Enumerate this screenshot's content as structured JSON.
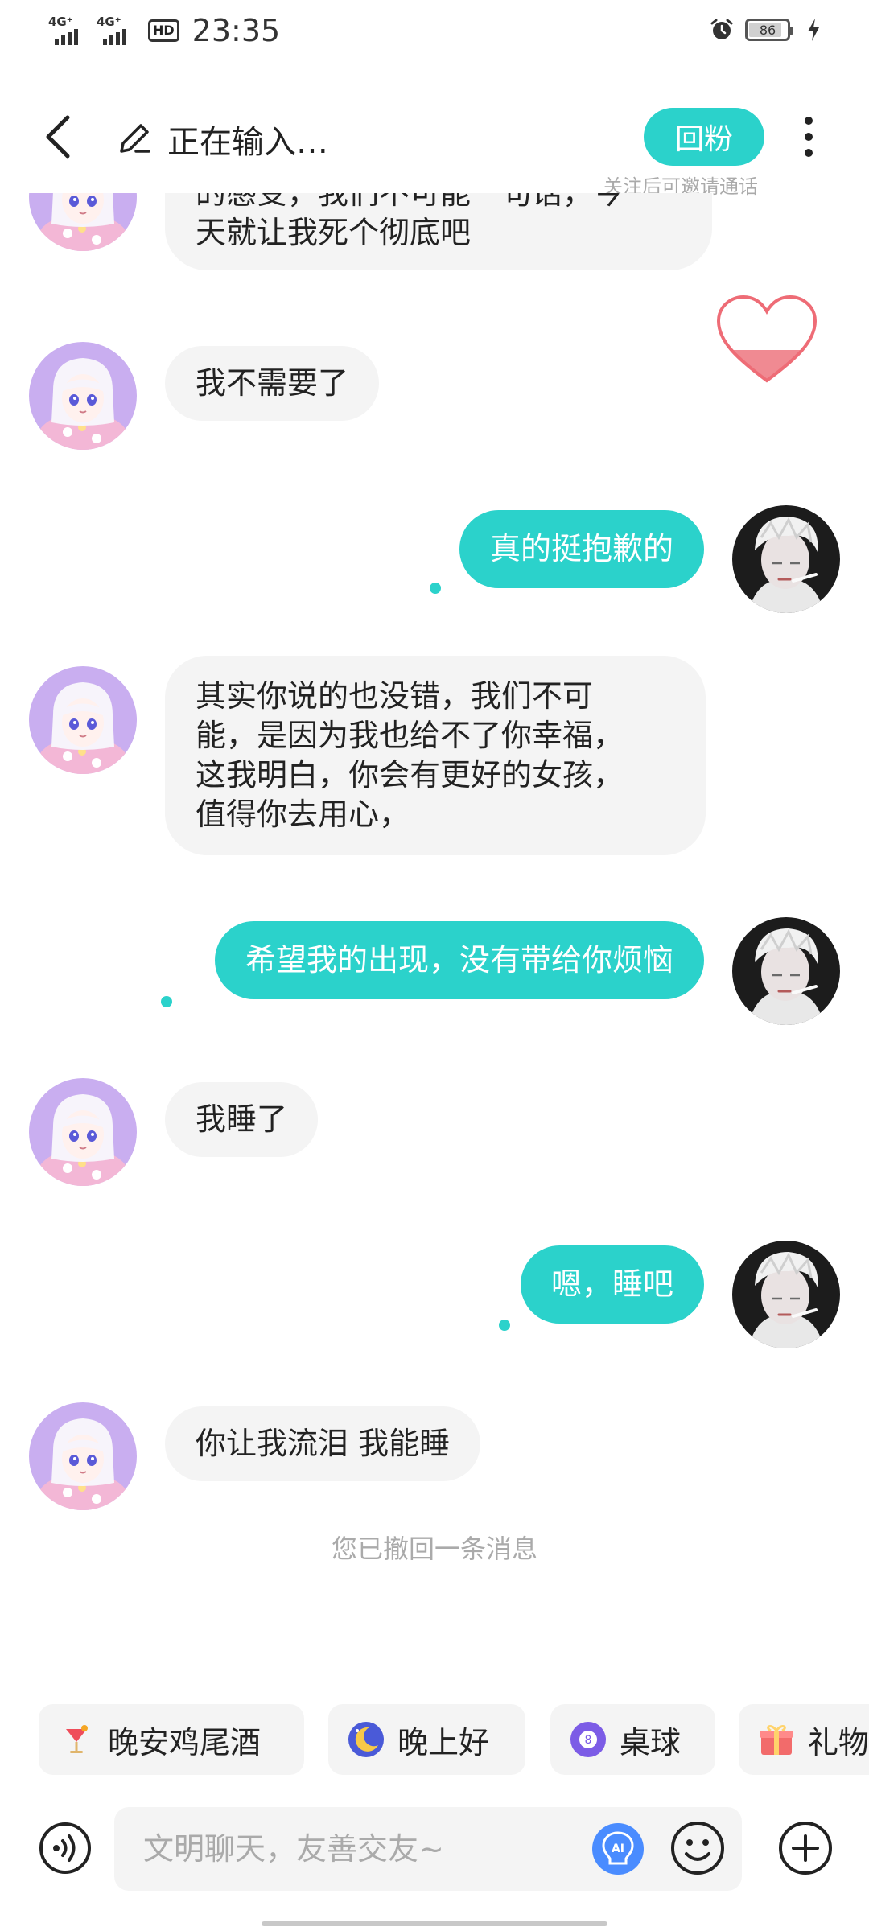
{
  "status_bar": {
    "sim1": "4G⁺",
    "sim2": "4G⁺",
    "hd": "HD",
    "time": "23:35",
    "battery_level": "86"
  },
  "header": {
    "title": "正在输入…",
    "follow_back": "回粉",
    "follow_hint": "关注后可邀请通话"
  },
  "messages": [
    {
      "side": "left",
      "text_lines": [
        "的感受，我们不可能一句话，今",
        "天就让我死个彻底吧"
      ]
    },
    {
      "side": "left",
      "text": "我不需要了"
    },
    {
      "side": "right",
      "text": "真的挺抱歉的"
    },
    {
      "side": "left",
      "text_lines": [
        "其实你说的也没错，我们不可",
        "能，是因为我也给不了你幸福，",
        "这我明白，你会有更好的女孩，",
        "值得你去用心，"
      ]
    },
    {
      "side": "right",
      "text": "希望我的出现，没有带给你烦恼"
    },
    {
      "side": "left",
      "text": "我睡了"
    },
    {
      "side": "right",
      "text": "嗯，睡吧"
    },
    {
      "side": "left",
      "text": "你让我流泪 我能睡"
    }
  ],
  "recall_notice": "您已撤回一条消息",
  "quick_replies": [
    {
      "label": "晚安鸡尾酒",
      "icon": "cocktail-icon"
    },
    {
      "label": "晚上好",
      "icon": "moon-icon"
    },
    {
      "label": "桌球",
      "icon": "billiard-ball-icon"
    },
    {
      "label": "礼物",
      "icon": "gift-icon"
    }
  ],
  "input": {
    "placeholder": "文明聊天，友善交友~"
  },
  "colors": {
    "accent": "#2bd2cb",
    "bubble_left": "#f4f4f4",
    "avatar_left_bg": "#c9aef0",
    "avatar_right_bg": "#1c1c1c"
  }
}
